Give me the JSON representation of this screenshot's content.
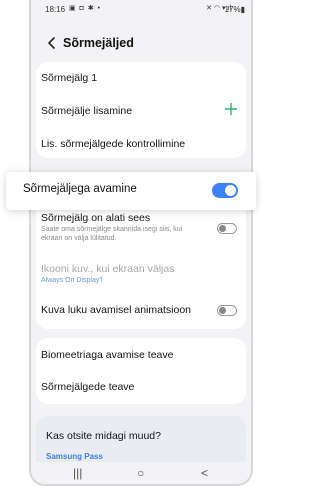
{
  "status_bar": {
    "time": "18:16",
    "left_icons": "▣ ◘ ✱ •",
    "right_icons": "✕ ◠ ▾.ıl",
    "battery": "17%▮"
  },
  "header": {
    "title": "Sõrmejäljed"
  },
  "section1": {
    "fingerprint_1": "Sõrmejälg 1",
    "add_fingerprint": "Sõrmejälje lisamine",
    "check_fingerprints": "Lis. sõrmejälgede kontrollimine"
  },
  "highlight": {
    "label": "Sõrmejäljega avamine",
    "toggle_state": "on"
  },
  "section2": {
    "always_on_title": "Sõrmejälg on alati sees",
    "always_on_sub": "Saate oma sõrmejälge skannida isegi siis, kui ekraan on välja lülitatud.",
    "icon_title": "Ikooni kuv., kui ekraan väljas",
    "icon_sub": "Always On Display'l",
    "animation_title": "Kuva luku avamisel animatsioon"
  },
  "section3": {
    "biometric_info": "Biomeetriaga avamise teave",
    "fingerprint_info": "Sõrmejälgede teave"
  },
  "section4": {
    "title": "Kas otsite midagi muud?",
    "link": "Samsung Pass"
  },
  "nav": {
    "recent": "|||",
    "home": "○",
    "back": "<"
  },
  "colors": {
    "accent": "#3d82f6",
    "plus": "#2fb26a"
  }
}
